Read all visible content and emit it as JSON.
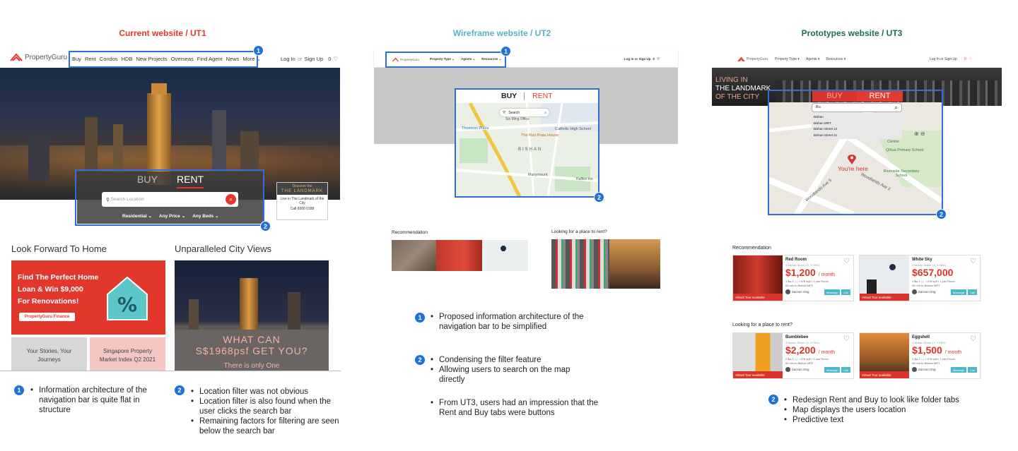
{
  "ut1": {
    "title": "Current website / UT1",
    "logo": "PropertyGuru",
    "nav_items": [
      "Buy",
      "Rent",
      "Condos",
      "HDB",
      "New Projects",
      "Overseas",
      "Find Agent",
      "News",
      "More ⌄"
    ],
    "login": "Log In",
    "or": "or",
    "signup": "Sign Up",
    "count": "0",
    "tab_buy": "BUY",
    "tab_rent": "RENT",
    "search_placeholder": "Search Location",
    "filters": [
      "Residential ⌄",
      "Any Price ⌄",
      "Any Beds ⌄"
    ],
    "ad_small": "Discover the",
    "ad_brand": "THE LANDMARK",
    "ad_text": "Live in The Landmark of the City",
    "ad_phone": "Call 6500 0188",
    "section1": "Look Forward To Home",
    "section2": "Unparalleled City Views",
    "promo_line1": "Find The Perfect Home",
    "promo_line2": "Loan & Win $9,000",
    "promo_line3": "For Renovations!",
    "promo_button": "PropertyGuru Finance",
    "tile1": "Your Stories, Your Journeys",
    "tile2": "Singapore Property Market Index Q2 2021",
    "city_text1": "WHAT CAN",
    "city_text2": "S$1968psf GET YOU?",
    "city_text3": "There is only One",
    "note1": "Information architecture of the navigation bar is quite flat in structure",
    "note2": [
      "Location filter was not obvious",
      "Location filter is also found when the user clicks the search bar",
      "Remaining factors for filtering are seen below the search bar"
    ]
  },
  "ut2": {
    "title": "Wireframe website / UT2",
    "logo": "PropertyGuru",
    "nav_items": [
      "Property Type ⌄",
      "Agents ⌄",
      "Resources ⌄"
    ],
    "auth": "Log In or Sign Up",
    "count": "0",
    "tab_buy": "BUY",
    "tab_rent": "RENT",
    "map_search": "Search",
    "map_labels": [
      "Thomson Plaza",
      "Sin Ming Office",
      "The Roti Prata House",
      "Catholic High School",
      "BISHAN",
      "Marymount",
      "Raffles Ins"
    ],
    "rec_label": "Recommendation",
    "rent_label": "Looking for a place to rent?",
    "note1": "Proposed information architecture of the navigation bar to be simplified",
    "note2": [
      "Condensing the filter feature",
      "Allowing users to search on the map directly"
    ],
    "note3": "From UT3, users had an impression that the Rent and Buy tabs were buttons"
  },
  "ut3": {
    "title": "Prototypes website / UT3",
    "logo": "PropertyGuru",
    "nav_items": [
      "Property Type ▾",
      "Agents ▾",
      "Resources ▾"
    ],
    "auth": "Log In or Sign Up",
    "count": "0",
    "hero1": "LIVING IN",
    "hero2": "THE LANDMARK",
    "hero3": "OF THE CITY",
    "tab_buy": "BUY",
    "tab_rent": "RENT",
    "search_value": "Bis",
    "suggestions": [
      "Bishan",
      "Bishan MRT",
      "Bishan Street 12",
      "Bishan Street 21"
    ],
    "you_are_here": "You're here",
    "map_labels": [
      "Qihua Primary School",
      "Riverside Secondary School",
      "Woodlands Ave 5",
      "Woodlands Ave 2",
      "Centre"
    ],
    "rec_label": "Recommendation",
    "rent_label": "Looking for a place to rent?",
    "cards": [
      {
        "title": "Red Room",
        "addr": "3 Bishan Street 13, 573911",
        "price": "$1,200",
        "unit": "/ month",
        "spec": "1 🛏  1 🛁  •  678 sqft  •  1 pax Room",
        "mrt": "05 min to Bishan MRT",
        "agent": "Zacson Ong",
        "virtual": "Virtual Tour available"
      },
      {
        "title": "White Sky",
        "addr": "3 Bishan Street 13, 573911",
        "price": "$657,000",
        "unit": "",
        "spec": "1 🛏  1 🛁  •  678 sqft  •  1 pax Room",
        "mrt": "05 min to Bishan MRT",
        "agent": "Zacson Ong",
        "virtual": "Virtual Tour available"
      },
      {
        "title": "Bumblebee",
        "addr": "3 Bishan Street 13, 573911",
        "price": "$2,200",
        "unit": "/ month",
        "spec": "2 🛏  1 🛁  •  678 sqft  •  1 pax Room",
        "mrt": "05 min to Bishan MRT",
        "agent": "Zacson Ong",
        "virtual": "Virtual Tour available"
      },
      {
        "title": "Eggshell",
        "addr": "3 Bishan Street 13, 573911",
        "price": "$1,500",
        "unit": "/ month",
        "spec": "1 🛏  1 🛁  •  678 sqft  •  1 pax Room",
        "mrt": "05 min to Bishan MRT",
        "agent": "Zacson Ong",
        "virtual": "Virtual Tour available"
      }
    ],
    "card_message": "Message",
    "card_call": "Call",
    "note2": [
      "Redesign Rent and Buy to look like folder tabs",
      "Map displays the users location",
      "Predictive text"
    ]
  },
  "badges": [
    "1",
    "2"
  ],
  "colors": {
    "ut1_title": "#e2372c",
    "ut2_title": "#52b6c4",
    "ut3_title": "#1c6b5e",
    "accent": "#d9342b",
    "badge": "#1e73d8"
  }
}
